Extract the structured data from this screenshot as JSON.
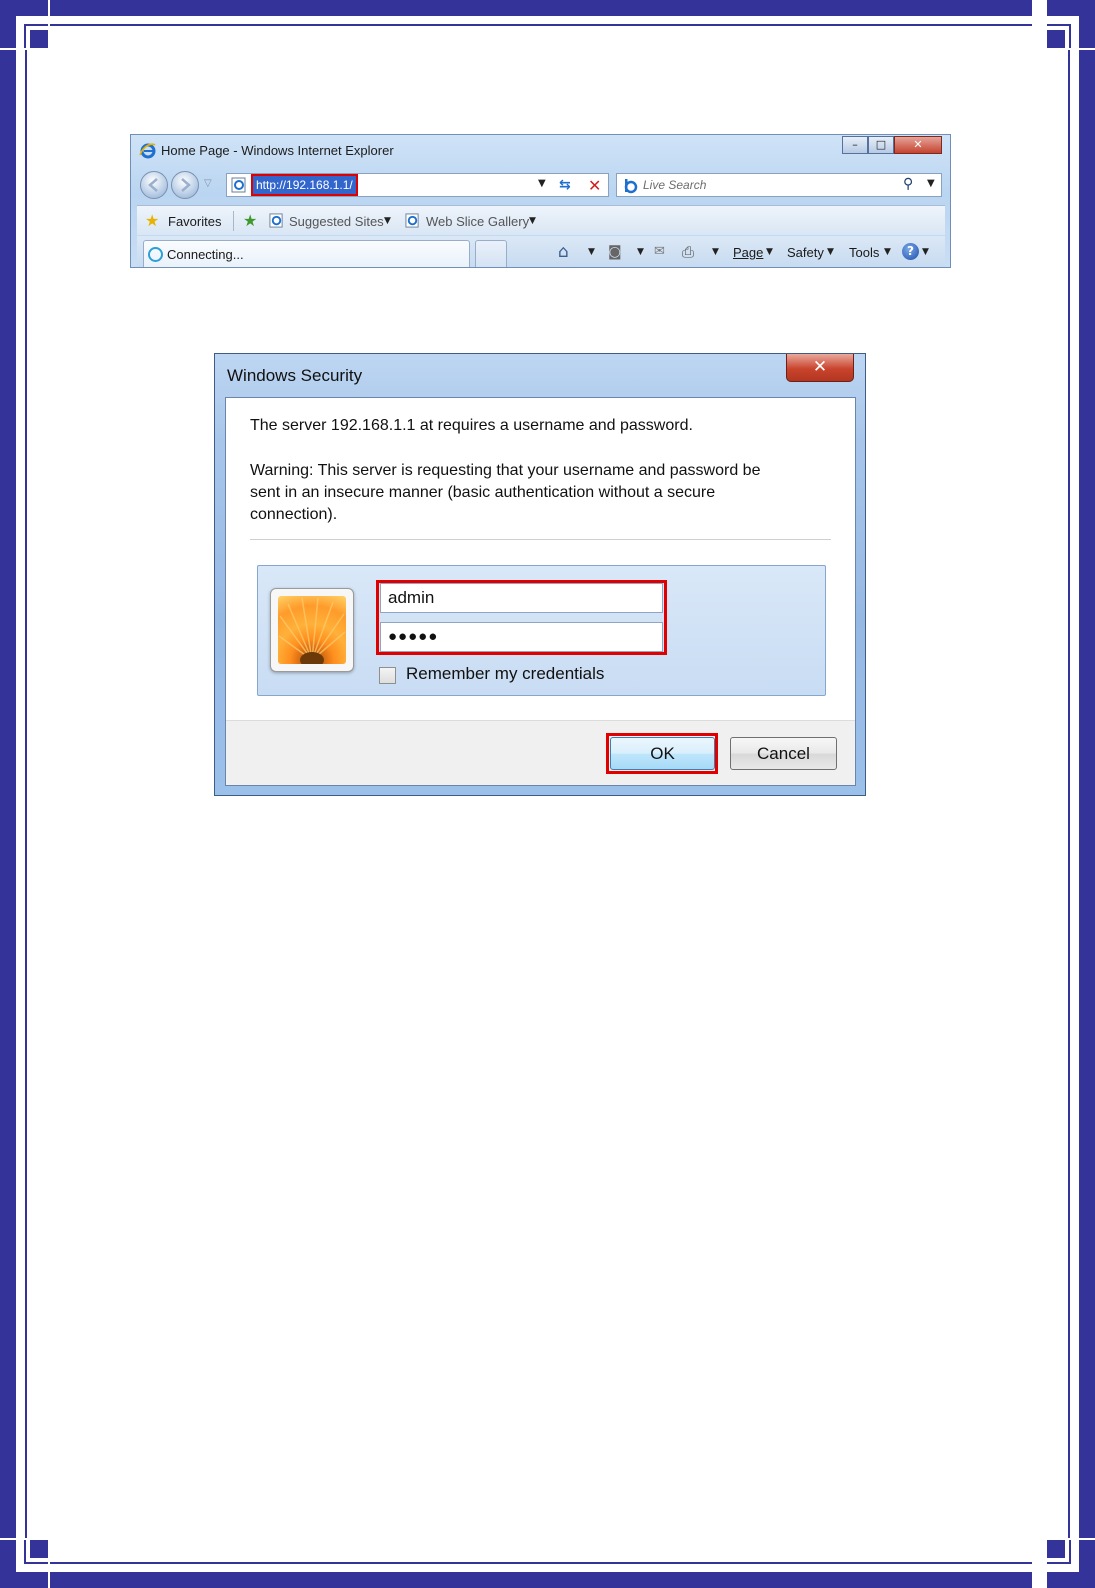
{
  "colors": {
    "page_frame": "#33339a",
    "highlight": "#e00000",
    "url_selection": "#3366cc"
  },
  "browser": {
    "title": "Home Page - Windows Internet Explorer",
    "address": "http://192.168.1.1/",
    "search_placeholder": "Live Search",
    "favorites": "Favorites",
    "suggested_sites": "Suggested Sites",
    "web_slice_gallery": "Web Slice Gallery",
    "tab_title": "Connecting...",
    "page_menu": "Page",
    "safety_menu": "Safety",
    "tools_menu": "Tools",
    "icons": [
      "ie-logo-icon",
      "back-icon",
      "forward-icon",
      "refresh-icon",
      "stop-icon",
      "search-icon",
      "star-icon",
      "home-icon",
      "feed-icon",
      "mail-icon",
      "print-icon",
      "help-icon"
    ]
  },
  "dialog": {
    "title": "Windows Security",
    "message": "The server 192.168.1.1 at  requires a username and password.",
    "warning_line1": "Warning: This server is requesting that your username and password be",
    "warning_line2": "sent in an insecure manner (basic authentication without a secure",
    "warning_line3": "connection).",
    "username": "admin",
    "password": "●●●●●",
    "remember_label": "Remember my credentials",
    "remember_checked": false,
    "ok_label": "OK",
    "cancel_label": "Cancel",
    "close_glyph": "✕"
  }
}
